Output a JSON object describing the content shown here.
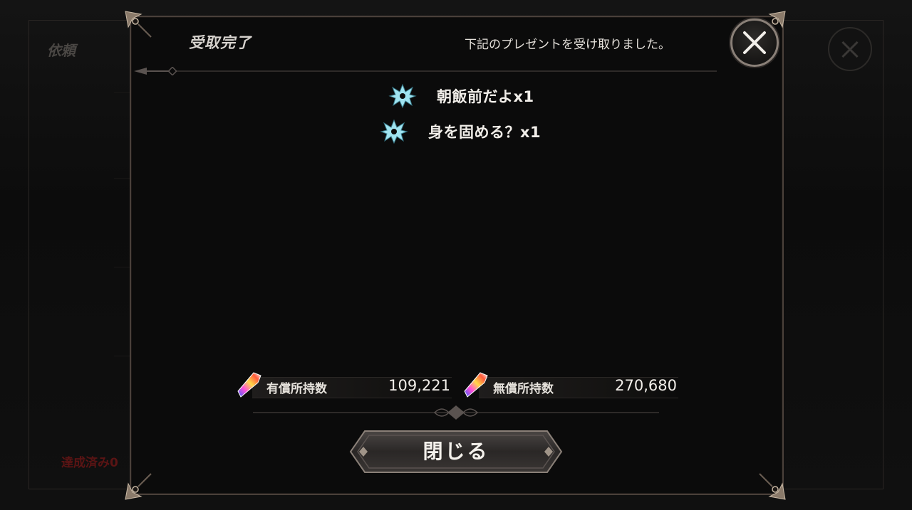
{
  "background": {
    "screen_title": "依頼",
    "achieved_text": "達成済み0"
  },
  "modal": {
    "title": "受取完了",
    "message": "下記のプレゼントを受け取りました。",
    "rewards": [
      {
        "icon": "crest-icon",
        "label": "朝飯前だよx1"
      },
      {
        "icon": "crest-icon",
        "label": "身を固める？x1"
      }
    ],
    "currency": {
      "paid": {
        "icon": "gem-icon",
        "label": "有償所持数",
        "value": "109,221"
      },
      "free": {
        "icon": "gem-icon",
        "label": "無償所持数",
        "value": "270,680"
      }
    },
    "close_button_label": "閉じる"
  },
  "colors": {
    "accent_frame": "#8a8078",
    "crest": "#9fe3f0"
  }
}
